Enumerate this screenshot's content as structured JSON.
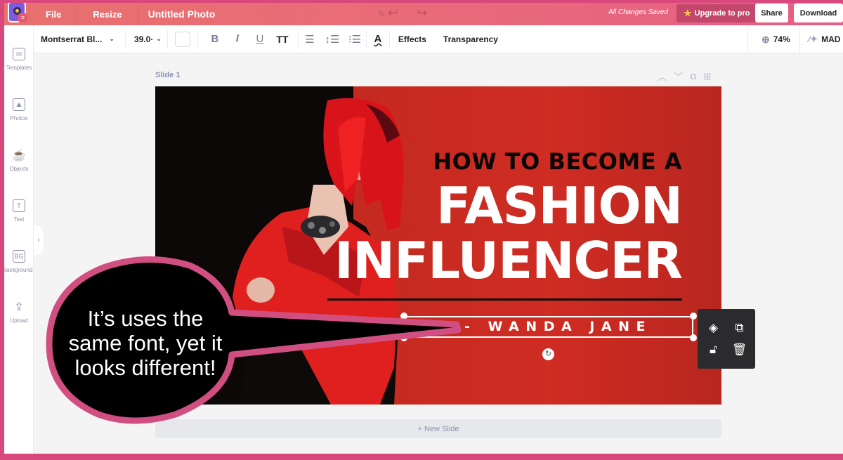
{
  "topbar": {
    "menu": [
      "File",
      "Resize"
    ],
    "document_title": "Untitled Photo",
    "save_status": "All Changes Saved",
    "upgrade_label": "Upgrade to pro",
    "share_label": "Share",
    "download_label": "Download"
  },
  "format_toolbar": {
    "font_family": "Montserrat Bl...",
    "font_size": "39.0·",
    "text_color": "#ffffff",
    "bold": "B",
    "italic": "I",
    "underline": "U",
    "uppercase": "TT",
    "effects_label": "Effects",
    "transparency_label": "Transparency",
    "zoom_level": "74%",
    "magic_label": "MAD"
  },
  "sidebar": {
    "items": [
      {
        "label": "Templates",
        "icon": "templates-icon"
      },
      {
        "label": "Photos",
        "icon": "photos-icon"
      },
      {
        "label": "Objects",
        "icon": "objects-icon"
      },
      {
        "label": "Text",
        "icon": "text-icon"
      },
      {
        "label": "Background",
        "icon": "background-icon"
      },
      {
        "label": "Upload",
        "icon": "upload-icon"
      }
    ]
  },
  "canvas": {
    "slide_label": "Slide 1",
    "headline_small": "HOW TO BECOME A",
    "headline_line1": "FASHION",
    "headline_line2": "INFLUENCER",
    "byline": "- WANDA JANE",
    "new_slide_label": "+ New Slide"
  },
  "callout": {
    "text_lines": [
      "It’s uses the",
      "same font, yet it",
      "looks different!"
    ]
  },
  "colors": {
    "brand_pink": "#d9487d",
    "topbar_coral": "#e8706e",
    "slide_red": "#c42a20",
    "callout_border": "#d14f80"
  }
}
